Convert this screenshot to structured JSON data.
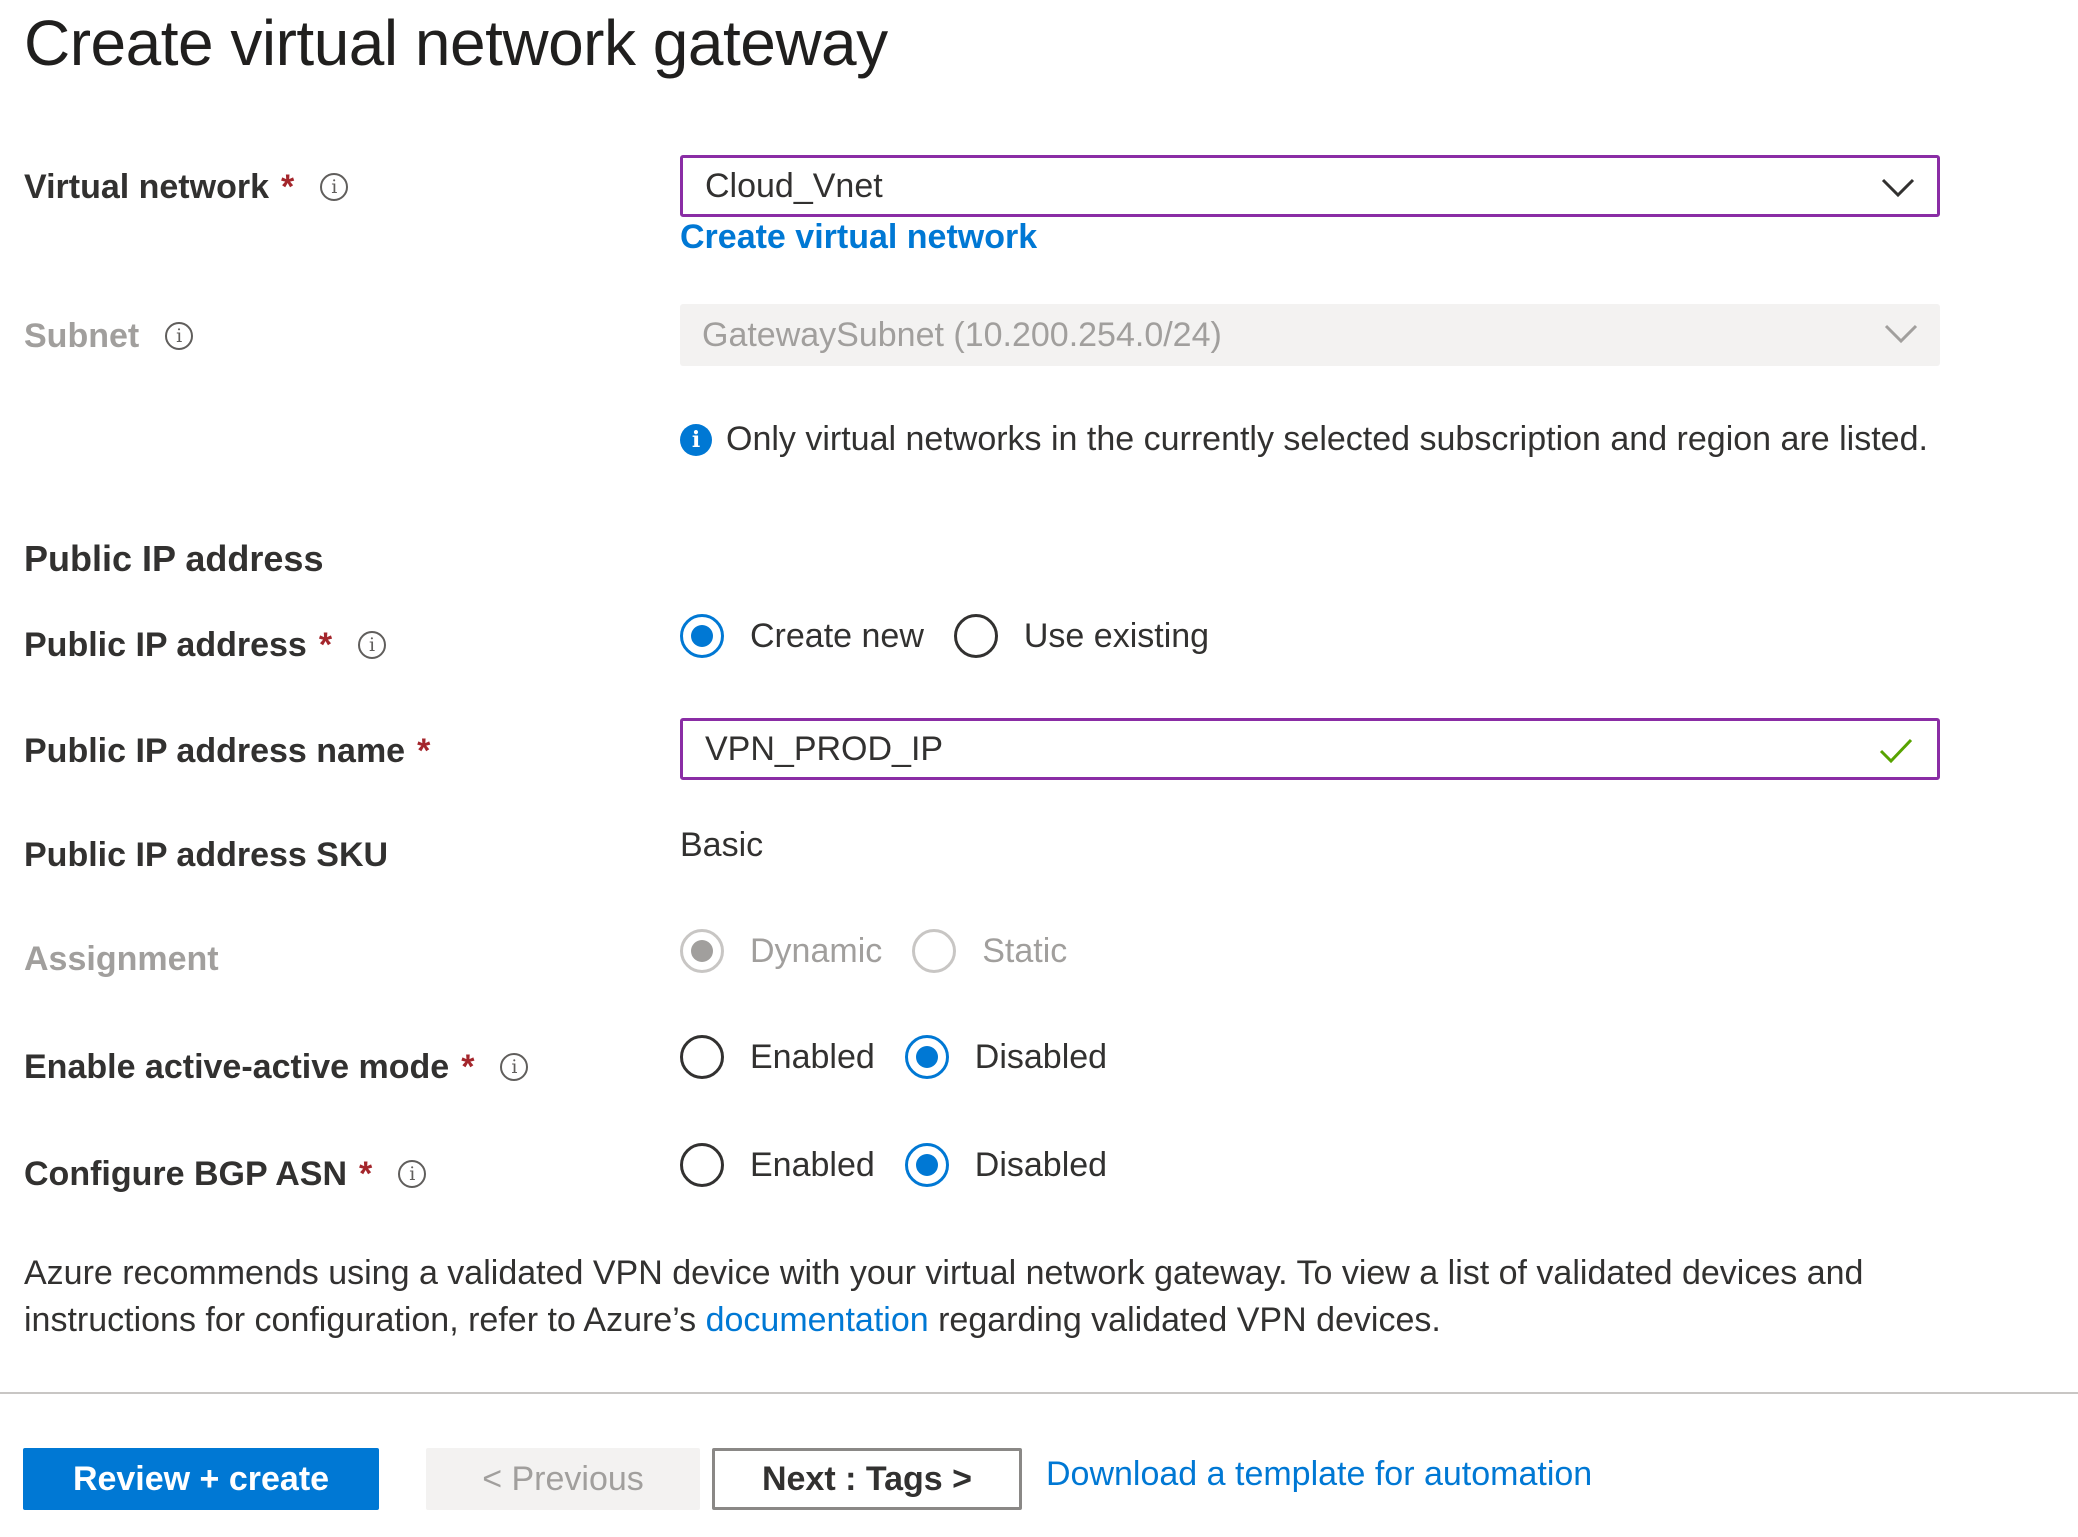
{
  "page": {
    "title": "Create virtual network gateway"
  },
  "virtual_network": {
    "label": "Virtual network",
    "required_mark": "*",
    "value": "Cloud_Vnet",
    "create_link": "Create virtual network"
  },
  "subnet": {
    "label": "Subnet",
    "value": "GatewaySubnet (10.200.254.0/24)"
  },
  "notice": {
    "text": "Only virtual networks in the currently selected subscription and region are listed."
  },
  "public_ip_section": {
    "heading": "Public IP address"
  },
  "public_ip": {
    "label": "Public IP address",
    "required_mark": "*",
    "options": [
      "Create new",
      "Use existing"
    ],
    "selected": "Create new"
  },
  "public_ip_name": {
    "label": "Public IP address name",
    "required_mark": "*",
    "value": "VPN_PROD_IP"
  },
  "public_ip_sku": {
    "label": "Public IP address SKU",
    "value": "Basic"
  },
  "assignment": {
    "label": "Assignment",
    "options": [
      "Dynamic",
      "Static"
    ],
    "selected": "Dynamic"
  },
  "active_active": {
    "label": "Enable active-active mode",
    "required_mark": "*",
    "options": [
      "Enabled",
      "Disabled"
    ],
    "selected": "Disabled"
  },
  "bgp_asn": {
    "label": "Configure BGP ASN",
    "required_mark": "*",
    "options": [
      "Enabled",
      "Disabled"
    ],
    "selected": "Disabled"
  },
  "recommendation": {
    "text_before": "Azure recommends using a validated VPN device with your virtual network gateway. To view a list of validated devices and instructions for configuration, refer to Azure’s ",
    "link": "documentation",
    "text_after": " regarding validated VPN devices."
  },
  "footer": {
    "review_create": "Review + create",
    "previous": "< Previous",
    "next": "Next : Tags >",
    "download_template": "Download a template for automation"
  },
  "colors": {
    "accent": "#0078d4",
    "focus_border": "#8a2da5",
    "required": "#a4262c",
    "valid_check": "#57a300",
    "disabled_text": "#a19f9d"
  }
}
